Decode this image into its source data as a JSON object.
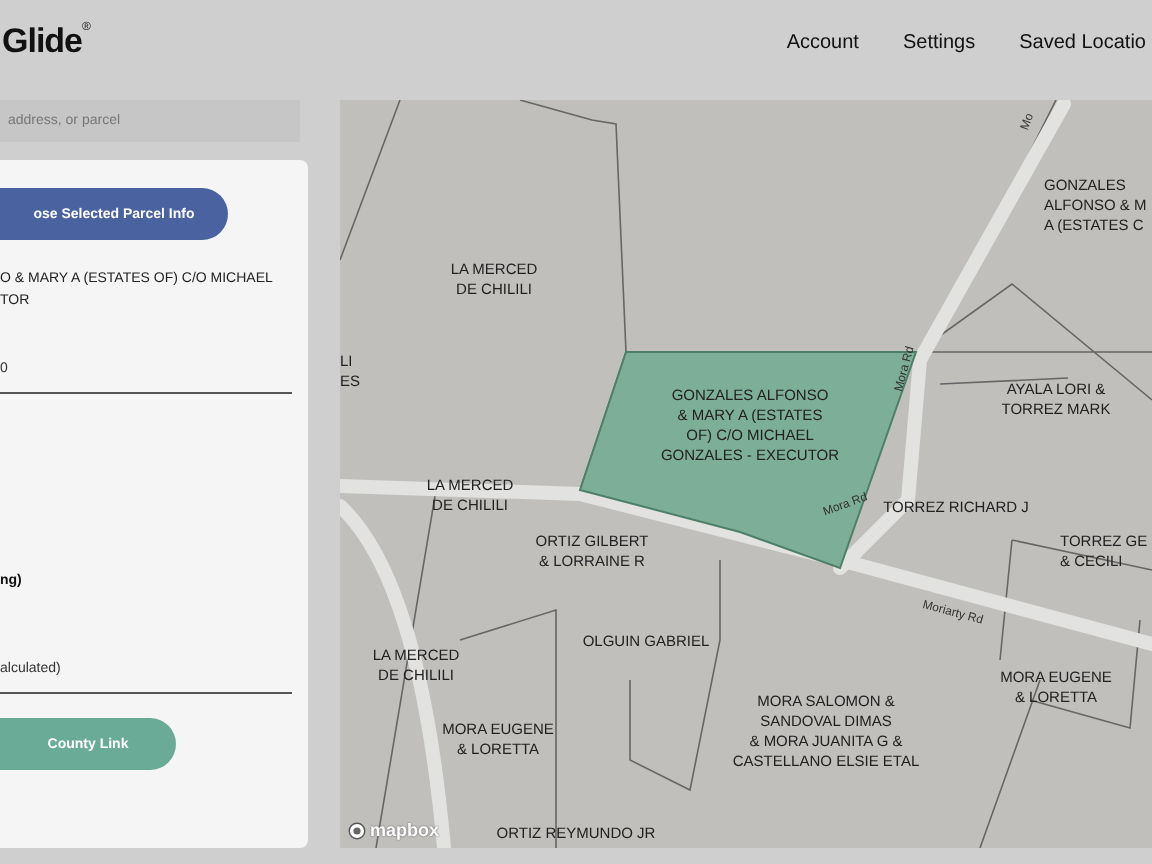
{
  "header": {
    "logo": "Glide",
    "logo_mark": "®",
    "nav": [
      "Account",
      "Settings",
      "Saved Locatio"
    ]
  },
  "search": {
    "placeholder": "address, or parcel"
  },
  "panel": {
    "close_button": "ose Selected Parcel Info",
    "owner": "O & MARY A (ESTATES OF) C/O MICHAEL\nTOR",
    "field_value": "0",
    "bold_label": "ng)",
    "note": "alculated)",
    "link_button": "County Link"
  },
  "map": {
    "attribution": "mapbox",
    "selected_parcel": "GONZALES ALFONSO\n& MARY A (ESTATES\nOF) C/O MICHAEL\nGONZALES - EXECUTOR",
    "labels": [
      {
        "text": "LA MERCED\nDE CHILILI"
      },
      {
        "text": "LI\nES"
      },
      {
        "text": "GONZALES\nALFONSO & M\nA (ESTATES C"
      },
      {
        "text": "AYALA LORI &\nTORREZ MARK"
      },
      {
        "text": "LA MERCED\nDE CHILILI"
      },
      {
        "text": "TORREZ RICHARD J"
      },
      {
        "text": "ORTIZ GILBERT\n& LORRAINE R"
      },
      {
        "text": "TORREZ GE\n& CECILI"
      },
      {
        "text": "OLGUIN GABRIEL"
      },
      {
        "text": "LA MERCED\nDE CHILILI"
      },
      {
        "text": "MORA EUGENE\n& LORETTA"
      },
      {
        "text": "MORA SALOMON &\nSANDOVAL DIMAS\n& MORA JUANITA G &\nCASTELLANO ELSIE ETAL"
      },
      {
        "text": "MORA EUGENE\n& LORETTA"
      },
      {
        "text": "ORTIZ REYMUNDO JR"
      }
    ],
    "roads": [
      {
        "text": "Mora Rd"
      },
      {
        "text": "Mora Rd"
      },
      {
        "text": "Moriarty Rd"
      },
      {
        "text": "Mo"
      }
    ]
  }
}
